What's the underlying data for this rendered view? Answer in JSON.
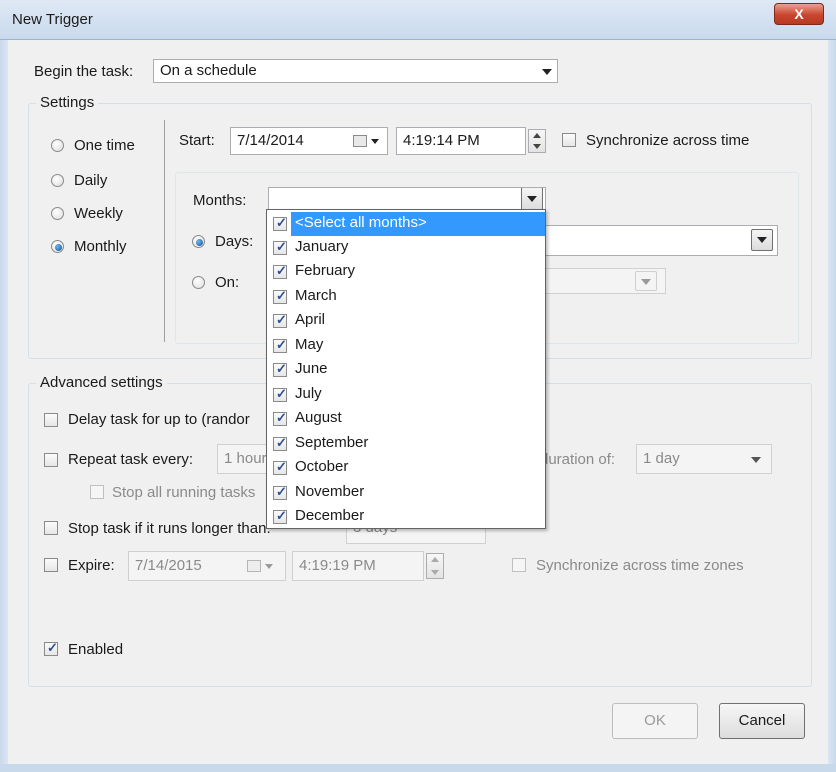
{
  "window": {
    "title": "New Trigger",
    "close_glyph": "X"
  },
  "begin": {
    "label": "Begin the task:",
    "value": "On a schedule"
  },
  "settings": {
    "title": "Settings",
    "radios": [
      {
        "label": "One time",
        "checked": false
      },
      {
        "label": "Daily",
        "checked": false
      },
      {
        "label": "Weekly",
        "checked": false
      },
      {
        "label": "Monthly",
        "checked": true
      }
    ],
    "start_label": "Start:",
    "start_date": "7/14/2014",
    "start_time": "4:19:14 PM",
    "sync_label": "Synchronize across time",
    "months_label": "Months:",
    "months_value": "",
    "days_label": "Days:",
    "on_label": "On:"
  },
  "months_dropdown": {
    "items": [
      "<Select all months>",
      "January",
      "February",
      "March",
      "April",
      "May",
      "June",
      "July",
      "August",
      "September",
      "October",
      "November",
      "December"
    ],
    "all_checked": true
  },
  "advanced": {
    "title": "Advanced settings",
    "delay_label": "Delay task for up to (randor",
    "repeat_label": "Repeat task every:",
    "repeat_value": "1 hour",
    "duration_label": "duration of:",
    "duration_value": "1 day",
    "stop_running_label": "Stop all running tasks",
    "stop_longer_label": "Stop task if it runs longer than:",
    "stop_longer_value": "3 days",
    "expire_label": "Expire:",
    "expire_date": "7/14/2015",
    "expire_time": "4:19:19 PM",
    "expire_sync_label": "Synchronize across time zones",
    "enabled_label": "Enabled"
  },
  "buttons": {
    "ok": "OK",
    "cancel": "Cancel"
  },
  "colors": {
    "selection": "#3399ff",
    "titlebar": "#c9d9ec",
    "close": "#c9462d"
  }
}
